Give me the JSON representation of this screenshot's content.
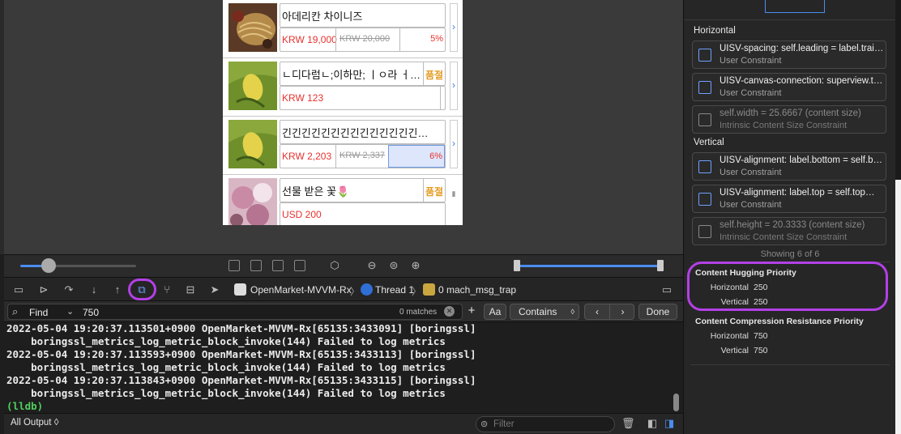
{
  "products": [
    {
      "title": "아데리칸 차이니즈",
      "price": "KRW 19,000",
      "original_price": "KRW 20,000",
      "discount": "5%",
      "stock": "",
      "thumb": "noodles"
    },
    {
      "title": "ㄴ디다럼ㄴ;이하만; ㅣㅇ라 ㅓ…",
      "price": "KRW 123",
      "original_price": "",
      "discount": "",
      "stock": "품절",
      "thumb": "lemon"
    },
    {
      "title": "긴긴긴긴긴긴긴긴긴긴긴긴긴긴…",
      "price": "KRW 2,203",
      "original_price": "KRW 2,337",
      "discount": "6%",
      "stock": "",
      "thumb": "lemon"
    },
    {
      "title": "선물 받은 꽃🌷",
      "price": "USD 200",
      "original_price": "",
      "discount": "",
      "stock": "품절",
      "thumb": "flowers"
    }
  ],
  "debug_bar": {
    "scheme": "OpenMarket-MVVM-Rx",
    "thread": "Thread 1",
    "frame": "0 mach_msg_trap"
  },
  "find_bar": {
    "mode": "Find",
    "query": "750",
    "matches": "0 matches",
    "case_button": "Aa",
    "match_type": "Contains",
    "done": "Done"
  },
  "console": {
    "lines": [
      "2022-05-04 19:20:37.113501+0900 OpenMarket-MVVM-Rx[65135:3433091] [boringssl]",
      "    boringssl_metrics_log_metric_block_invoke(144) Failed to log metrics",
      "2022-05-04 19:20:37.113593+0900 OpenMarket-MVVM-Rx[65135:3433113] [boringssl]",
      "    boringssl_metrics_log_metric_block_invoke(144) Failed to log metrics",
      "2022-05-04 19:20:37.113843+0900 OpenMarket-MVVM-Rx[65135:3433115] [boringssl]",
      "    boringssl_metrics_log_metric_block_invoke(144) Failed to log metrics"
    ],
    "prompt": "(lldb)",
    "output_selector": "All Output ◊",
    "filter_placeholder": "Filter"
  },
  "inspector": {
    "horizontal_title": "Horizontal",
    "vertical_title": "Vertical",
    "horizontal_constraints": [
      {
        "title": "UISV-spacing: self.leading = label.trai…",
        "subtitle": "User Constraint",
        "dim": false
      },
      {
        "title": "UISV-canvas-connection: superview.t…",
        "subtitle": "User Constraint",
        "dim": false
      },
      {
        "title": "self.width = 25.6667 (content size)",
        "subtitle": "Intrinsic Content Size Constraint",
        "dim": true
      }
    ],
    "vertical_constraints": [
      {
        "title": "UISV-alignment: label.bottom = self.b…",
        "subtitle": "User Constraint",
        "dim": false
      },
      {
        "title": "UISV-alignment: label.top = self.top…",
        "subtitle": "User Constraint",
        "dim": false
      },
      {
        "title": "self.height = 20.3333 (content size)",
        "subtitle": "Intrinsic Content Size Constraint",
        "dim": true
      }
    ],
    "showing": "Showing 6 of 6",
    "hugging": {
      "title": "Content Hugging Priority",
      "horizontal_label": "Horizontal",
      "horizontal": "250",
      "vertical_label": "Vertical",
      "vertical": "250"
    },
    "compression": {
      "title": "Content Compression Resistance Priority",
      "horizontal_label": "Horizontal",
      "horizontal": "750",
      "vertical_label": "Vertical",
      "vertical": "750"
    }
  },
  "colors": {
    "highlight": "#b340e6",
    "accent": "#3a7bd5",
    "price_red": "#e8322e",
    "stock_orange": "#e49a1f"
  }
}
